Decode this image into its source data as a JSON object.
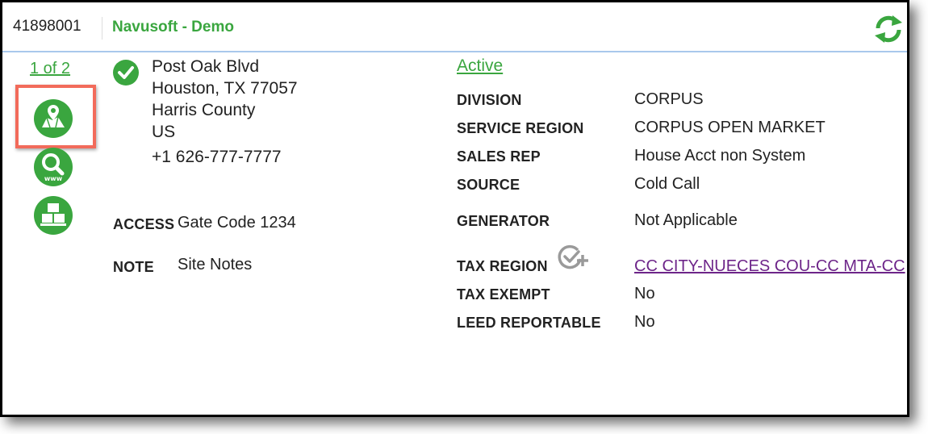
{
  "header": {
    "account_id": "41898001",
    "account_name": "Navusoft - Demo",
    "refresh_icon": "refresh-icon"
  },
  "sidebar": {
    "pager": "1 of 2",
    "icons": [
      "map-location-icon",
      "web-search-icon",
      "containers-icon"
    ]
  },
  "address": {
    "street": "Post Oak Blvd",
    "city_line": "Houston, TX 77057",
    "county": "Harris County",
    "country": "US",
    "phone": "+1 626-777-7777"
  },
  "access": {
    "label": "ACCESS",
    "value": "Gate Code 1234"
  },
  "note": {
    "label": "NOTE",
    "value": "Site Notes"
  },
  "details": {
    "status": "Active",
    "division": {
      "label": "DIVISION",
      "value": "CORPUS"
    },
    "service_region": {
      "label": "SERVICE REGION",
      "value": "CORPUS OPEN MARKET"
    },
    "sales_rep": {
      "label": "SALES REP",
      "value": "House Acct non System"
    },
    "source": {
      "label": "SOURCE",
      "value": "Cold Call"
    },
    "generator": {
      "label": "GENERATOR",
      "value": "Not Applicable"
    },
    "tax_region": {
      "label": "TAX REGION",
      "value": "CC CITY-NUECES COU-CC MTA-CC"
    },
    "tax_exempt": {
      "label": "TAX EXEMPT",
      "value": "No"
    },
    "leed_reportable": {
      "label": "LEED REPORTABLE",
      "value": "No"
    }
  },
  "colors": {
    "accent_green": "#3aa63f",
    "link_purple": "#6d2589",
    "highlight_red": "#f26b5b",
    "header_rule": "#a9c8ec"
  }
}
